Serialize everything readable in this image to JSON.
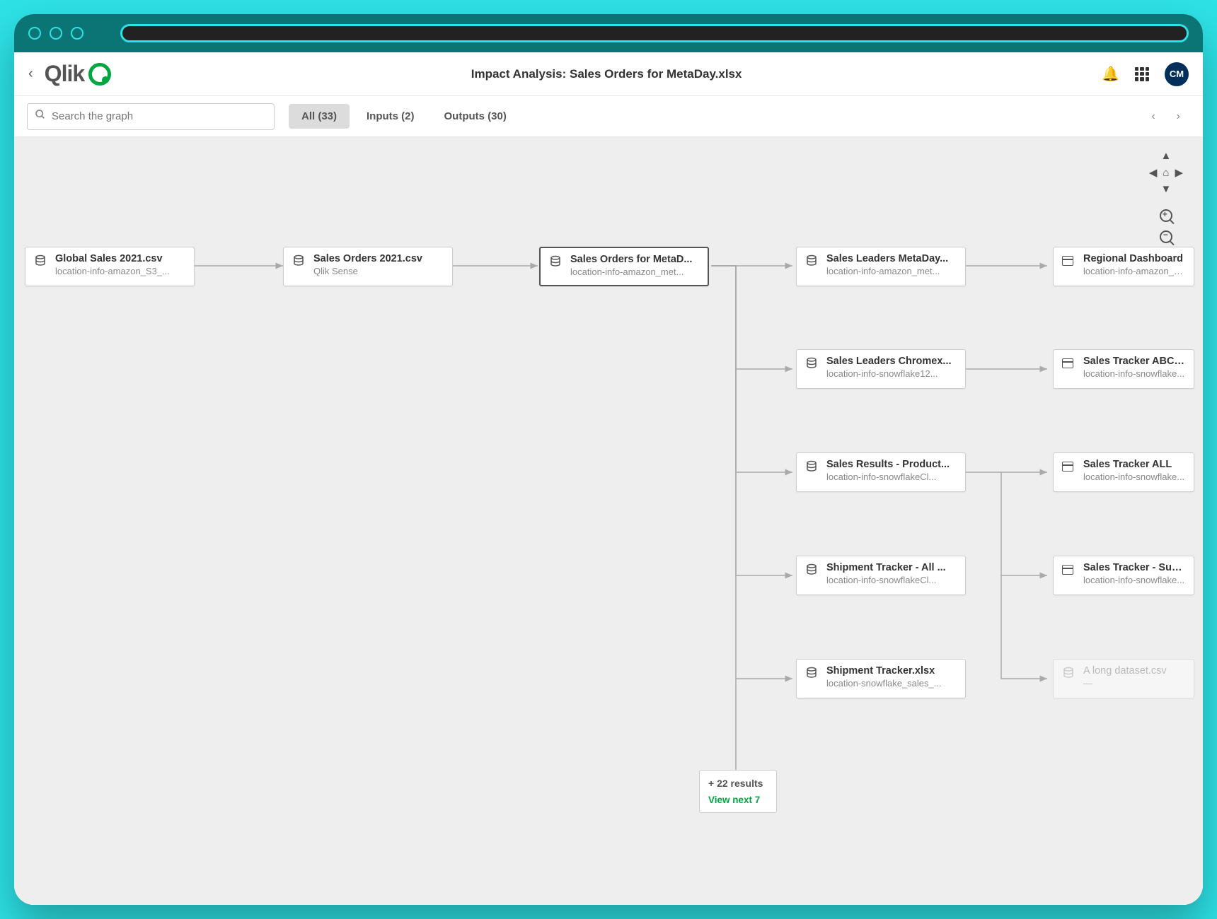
{
  "header": {
    "logo_text": "Qlik",
    "page_title": "Impact Analysis: Sales Orders for MetaDay.xlsx",
    "avatar_initials": "CM"
  },
  "toolbar": {
    "search_placeholder": "Search the graph",
    "tabs": [
      {
        "label": "All (33)",
        "active": true
      },
      {
        "label": "Inputs (2)",
        "active": false
      },
      {
        "label": "Outputs (30)",
        "active": false
      }
    ]
  },
  "nodes": {
    "c0r0": {
      "title": "Global Sales 2021.csv",
      "sub": "location-info-amazon_S3_...",
      "icon": "db"
    },
    "c1r0": {
      "title": "Sales Orders 2021.csv",
      "sub": "Qlik Sense",
      "icon": "db"
    },
    "c2r0": {
      "title": "Sales Orders for MetaD...",
      "sub": "location-info-amazon_met...",
      "icon": "db",
      "selected": true
    },
    "c3r0": {
      "title": "Sales Leaders MetaDay...",
      "sub": "location-info-amazon_met...",
      "icon": "db"
    },
    "c3r1": {
      "title": "Sales Leaders Chromex...",
      "sub": "location-info-snowflake12...",
      "icon": "db"
    },
    "c3r2": {
      "title": "Sales Results - Product...",
      "sub": "location-info-snowflakeCl...",
      "icon": "db"
    },
    "c3r3": {
      "title": "Shipment Tracker - All ...",
      "sub": "location-info-snowflakeCl...",
      "icon": "db"
    },
    "c3r4": {
      "title": "Shipment Tracker.xlsx",
      "sub": "location-snowflake_sales_...",
      "icon": "db"
    },
    "c4r0": {
      "title": "Regional Dashboard",
      "sub": "location-info-amazon_m...",
      "icon": "dash"
    },
    "c4r1": {
      "title": "Sales Tracker ABC Da...",
      "sub": "location-info-snowflake...",
      "icon": "dash"
    },
    "c4r2": {
      "title": "Sales Tracker ALL",
      "sub": "location-info-snowflake...",
      "icon": "dash"
    },
    "c4r3": {
      "title": "Sales Tracker - Sub-P...",
      "sub": "location-info-snowflake...",
      "icon": "dash"
    },
    "c4r4": {
      "title": "A long dataset.csv",
      "sub": "—",
      "icon": "db",
      "faded": true
    }
  },
  "more": {
    "count_label": "+ 22  results",
    "link_label": "View next 7"
  }
}
